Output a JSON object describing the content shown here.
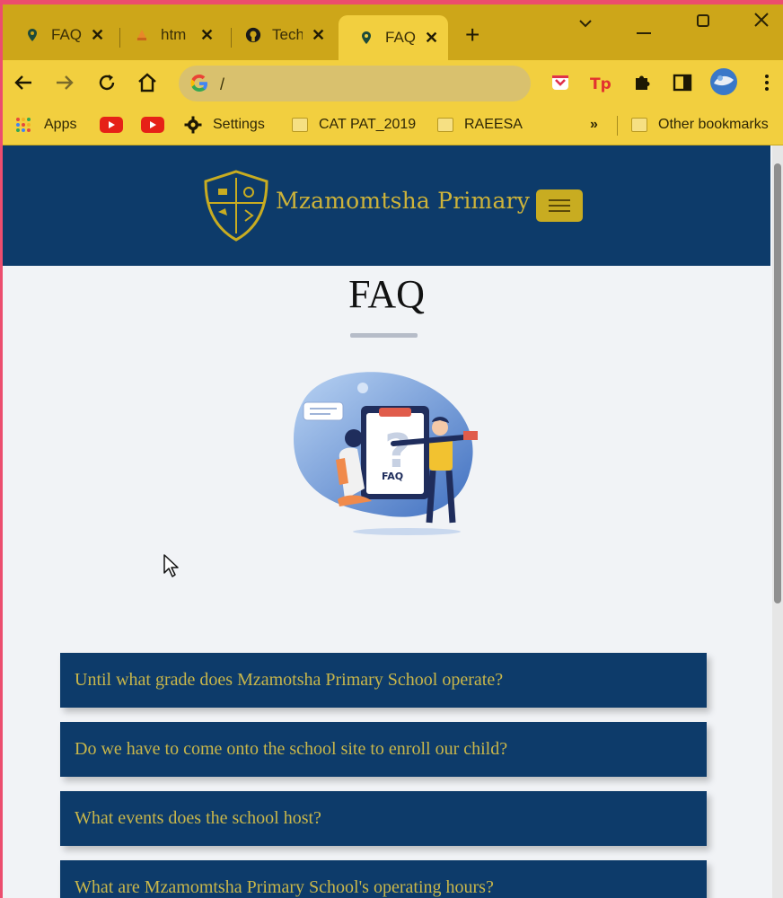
{
  "browser": {
    "tabs": [
      {
        "title": "FAQ",
        "active": false
      },
      {
        "title": "htm",
        "active": false
      },
      {
        "title": "Tech",
        "active": false
      },
      {
        "title": "FAQ",
        "active": true
      }
    ],
    "address": "/",
    "bookmarks": [
      "Apps",
      "Settings",
      "CAT PAT_2019",
      "RAEESA",
      "Other bookmarks"
    ],
    "overflow_label": "»"
  },
  "site": {
    "name": "Mzamomtsha Primary",
    "page_title": "FAQ",
    "illustration_label": "FAQ"
  },
  "faq": [
    "Until what grade does Mzamotsha Primary School operate?",
    "Do we have to come onto the school site to enroll our child?",
    "What events does the school host?",
    "What are Mzamomtsha Primary School's operating hours?"
  ],
  "colors": {
    "header": "#0d3b6a",
    "accent_gold": "#c8ac21",
    "browser_chrome": "#f2cf3f"
  }
}
